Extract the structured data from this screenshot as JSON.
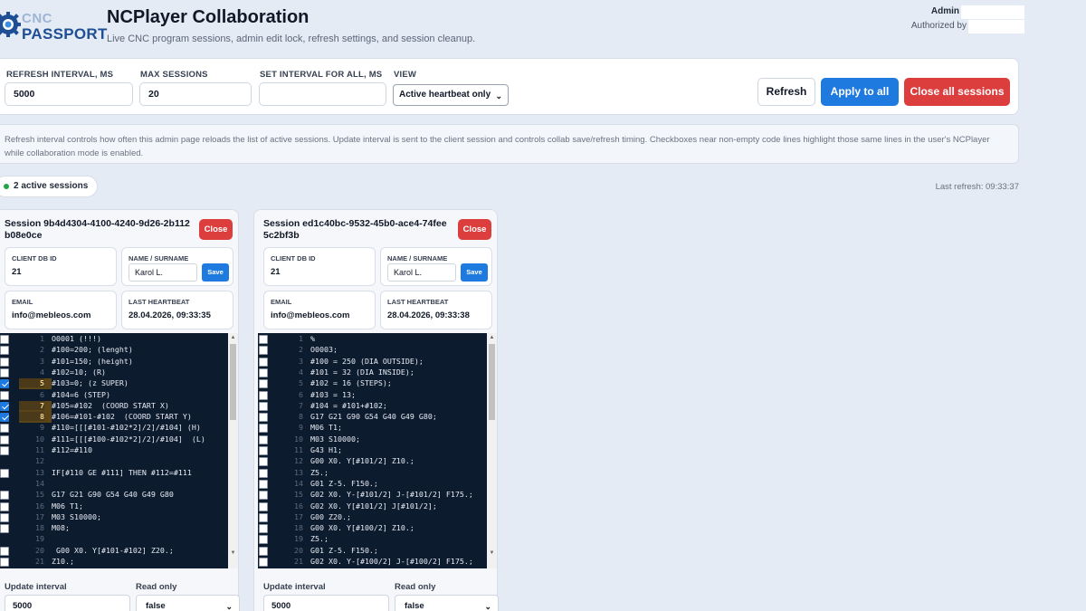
{
  "header": {
    "logo_top": "CNC",
    "logo_bottom": "PASSPORT",
    "title": "NCPlayer Collaboration",
    "subtitle": "Live CNC program sessions, admin edit lock, refresh settings, and session cleanup.",
    "role": "Admin",
    "authorized_by": "Authorized by"
  },
  "controls": {
    "refresh_label": "REFRESH INTERVAL, MS",
    "refresh_value": "5000",
    "max_label": "MAX SESSIONS",
    "max_value": "20",
    "setall_label": "SET INTERVAL FOR ALL, MS",
    "setall_value": "",
    "view_label": "VIEW",
    "view_value": "Active heartbeat only",
    "refresh_button": "Refresh",
    "apply_button": "Apply to all",
    "close_all_button": "Close all sessions"
  },
  "info_text": "Refresh interval controls how often this admin page reloads the list of active sessions. Update interval is sent to the client session and controls collab save/refresh timing. Checkboxes near non-empty code lines highlight those same lines in the user's NCPlayer while collaboration mode is enabled.",
  "status": {
    "active_sessions": "2 active sessions",
    "last_refresh": "Last refresh: 09:33:37"
  },
  "sessions": [
    {
      "title": "Session 9b4d4304-4100-4240-9d26-2b112b08e0ce",
      "close_label": "Close",
      "client_db_label": "CLIENT DB ID",
      "client_db_value": "21",
      "name_label": "NAME / SURNAME",
      "name_value": "Karol L.",
      "save_label": "Save",
      "email_label": "EMAIL",
      "email_value": "info@mebleos.com",
      "heartbeat_label": "LAST HEARTBEAT",
      "heartbeat_value": "28.04.2026, 09:33:35",
      "update_label": "Update interval",
      "update_value": "5000",
      "readonly_label": "Read only",
      "readonly_value": "false",
      "lines": [
        {
          "n": "1",
          "code": "O0001 (!!!)",
          "checked": false,
          "box": true
        },
        {
          "n": "2",
          "code": "#100=200; (lenght)",
          "checked": false,
          "box": true
        },
        {
          "n": "3",
          "code": "#101=150; (height)",
          "checked": false,
          "box": true
        },
        {
          "n": "4",
          "code": "#102=10; (R)",
          "checked": false,
          "box": true
        },
        {
          "n": "5",
          "code": "#103=0; (z SUPER)",
          "checked": true,
          "box": true
        },
        {
          "n": "6",
          "code": "#104=6 (STEP)",
          "checked": false,
          "box": true
        },
        {
          "n": "7",
          "code": "#105=#102  (COORD START X)",
          "checked": true,
          "box": true
        },
        {
          "n": "8",
          "code": "#106=#101-#102  (COORD START Y)",
          "checked": true,
          "box": true
        },
        {
          "n": "9",
          "code": "#110=[[[#101-#102*2]/2]/#104] (H)",
          "checked": false,
          "box": true
        },
        {
          "n": "10",
          "code": "#111=[[[#100-#102*2]/2]/#104]  (L)",
          "checked": false,
          "box": true
        },
        {
          "n": "11",
          "code": "#112=#110",
          "checked": false,
          "box": true
        },
        {
          "n": "12",
          "code": "",
          "checked": false,
          "box": false
        },
        {
          "n": "13",
          "code": "IF[#110 GE #111] THEN #112=#111",
          "checked": false,
          "box": true
        },
        {
          "n": "14",
          "code": "",
          "checked": false,
          "box": false
        },
        {
          "n": "15",
          "code": "G17 G21 G90 G54 G40 G49 G80",
          "checked": false,
          "box": true
        },
        {
          "n": "16",
          "code": "M06 T1;",
          "checked": false,
          "box": true
        },
        {
          "n": "17",
          "code": "M03 S10000;",
          "checked": false,
          "box": true
        },
        {
          "n": "18",
          "code": "M08;",
          "checked": false,
          "box": true
        },
        {
          "n": "19",
          "code": "",
          "checked": false,
          "box": false
        },
        {
          "n": "20",
          "code": " G00 X0. Y[#101-#102] Z20.;",
          "checked": false,
          "box": true
        },
        {
          "n": "21",
          "code": "Z10.;",
          "checked": false,
          "box": true
        }
      ]
    },
    {
      "title": "Session ed1c40bc-9532-45b0-ace4-74fee5c2bf3b",
      "close_label": "Close",
      "client_db_label": "CLIENT DB ID",
      "client_db_value": "21",
      "name_label": "NAME / SURNAME",
      "name_value": "Karol L.",
      "save_label": "Save",
      "email_label": "EMAIL",
      "email_value": "info@mebleos.com",
      "heartbeat_label": "LAST HEARTBEAT",
      "heartbeat_value": "28.04.2026, 09:33:38",
      "update_label": "Update interval",
      "update_value": "5000",
      "readonly_label": "Read only",
      "readonly_value": "false",
      "lines": [
        {
          "n": "1",
          "code": "%",
          "checked": false,
          "box": true
        },
        {
          "n": "2",
          "code": "O0003;",
          "checked": false,
          "box": true
        },
        {
          "n": "3",
          "code": "#100 = 250 (DIA OUTSIDE);",
          "checked": false,
          "box": true
        },
        {
          "n": "4",
          "code": "#101 = 32 (DIA INSIDE);",
          "checked": false,
          "box": true
        },
        {
          "n": "5",
          "code": "#102 = 16 (STEPS);",
          "checked": false,
          "box": true
        },
        {
          "n": "6",
          "code": "#103 = 13;",
          "checked": false,
          "box": true
        },
        {
          "n": "7",
          "code": "#104 = #101+#102;",
          "checked": false,
          "box": true
        },
        {
          "n": "8",
          "code": "G17 G21 G90 G54 G40 G49 G80;",
          "checked": false,
          "box": true
        },
        {
          "n": "9",
          "code": "M06 T1;",
          "checked": false,
          "box": true
        },
        {
          "n": "10",
          "code": "M03 S10000;",
          "checked": false,
          "box": true
        },
        {
          "n": "11",
          "code": "G43 H1;",
          "checked": false,
          "box": true
        },
        {
          "n": "12",
          "code": "G00 X0. Y[#101/2] Z10.;",
          "checked": false,
          "box": true
        },
        {
          "n": "13",
          "code": "Z5.;",
          "checked": false,
          "box": true
        },
        {
          "n": "14",
          "code": "G01 Z-5. F150.;",
          "checked": false,
          "box": true
        },
        {
          "n": "15",
          "code": "G02 X0. Y-[#101/2] J-[#101/2] F175.;",
          "checked": false,
          "box": true
        },
        {
          "n": "16",
          "code": "G02 X0. Y[#101/2] J[#101/2];",
          "checked": false,
          "box": true
        },
        {
          "n": "17",
          "code": "G00 Z20.;",
          "checked": false,
          "box": true
        },
        {
          "n": "18",
          "code": "G00 X0. Y[#100/2] Z10.;",
          "checked": false,
          "box": true
        },
        {
          "n": "19",
          "code": "Z5.;",
          "checked": false,
          "box": true
        },
        {
          "n": "20",
          "code": "G01 Z-5. F150.;",
          "checked": false,
          "box": true
        },
        {
          "n": "21",
          "code": "G02 X0. Y-[#100/2] J-[#100/2] F175.;",
          "checked": false,
          "box": true
        }
      ]
    }
  ],
  "colors": {
    "primary": "#1f7ae0",
    "danger": "#dc3d3d",
    "editor_bg": "#0d1b2e",
    "active_dot": "#22a447"
  }
}
